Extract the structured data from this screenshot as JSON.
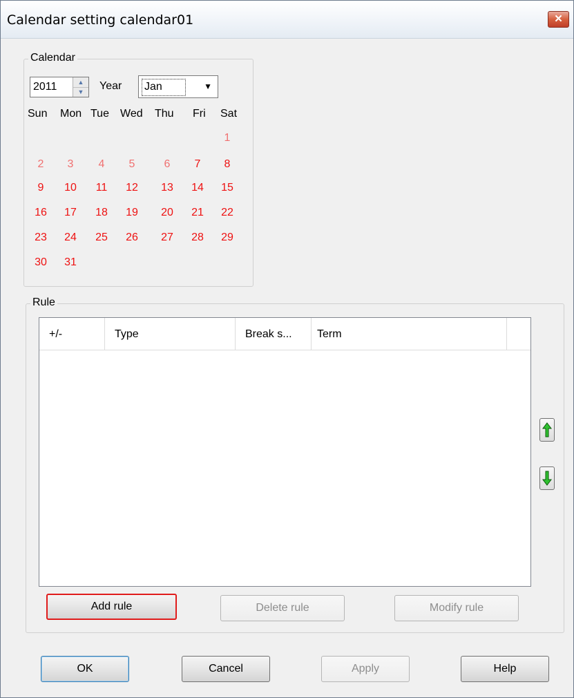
{
  "window": {
    "title": "Calendar setting calendar01",
    "close_label": "✕"
  },
  "calendar": {
    "group_label": "Calendar",
    "year_value": "2011",
    "year_label": "Year",
    "month_value": "Jan",
    "weekday_headers": [
      "Sun",
      "Mon",
      "Tue",
      "Wed",
      "Thu",
      "Fri",
      "Sat"
    ],
    "days": [
      "1",
      "2",
      "3",
      "4",
      "5",
      "6",
      "7",
      "8",
      "9",
      "10",
      "11",
      "12",
      "13",
      "14",
      "15",
      "16",
      "17",
      "18",
      "19",
      "20",
      "21",
      "22",
      "23",
      "24",
      "25",
      "26",
      "27",
      "28",
      "29",
      "30",
      "31"
    ],
    "day_colors": {
      "pale": "#f07070",
      "red": "#ee1111"
    }
  },
  "rule": {
    "group_label": "Rule",
    "columns": [
      "+/-",
      "Type",
      "Break s...",
      "Term"
    ],
    "rows": [],
    "move_up_icon": "green-up-arrow-icon",
    "move_down_icon": "green-down-arrow-icon",
    "add_rule": "Add rule",
    "delete_rule": "Delete rule",
    "modify_rule": "Modify rule"
  },
  "dialog_buttons": {
    "ok": "OK",
    "cancel": "Cancel",
    "apply": "Apply",
    "help": "Help"
  }
}
